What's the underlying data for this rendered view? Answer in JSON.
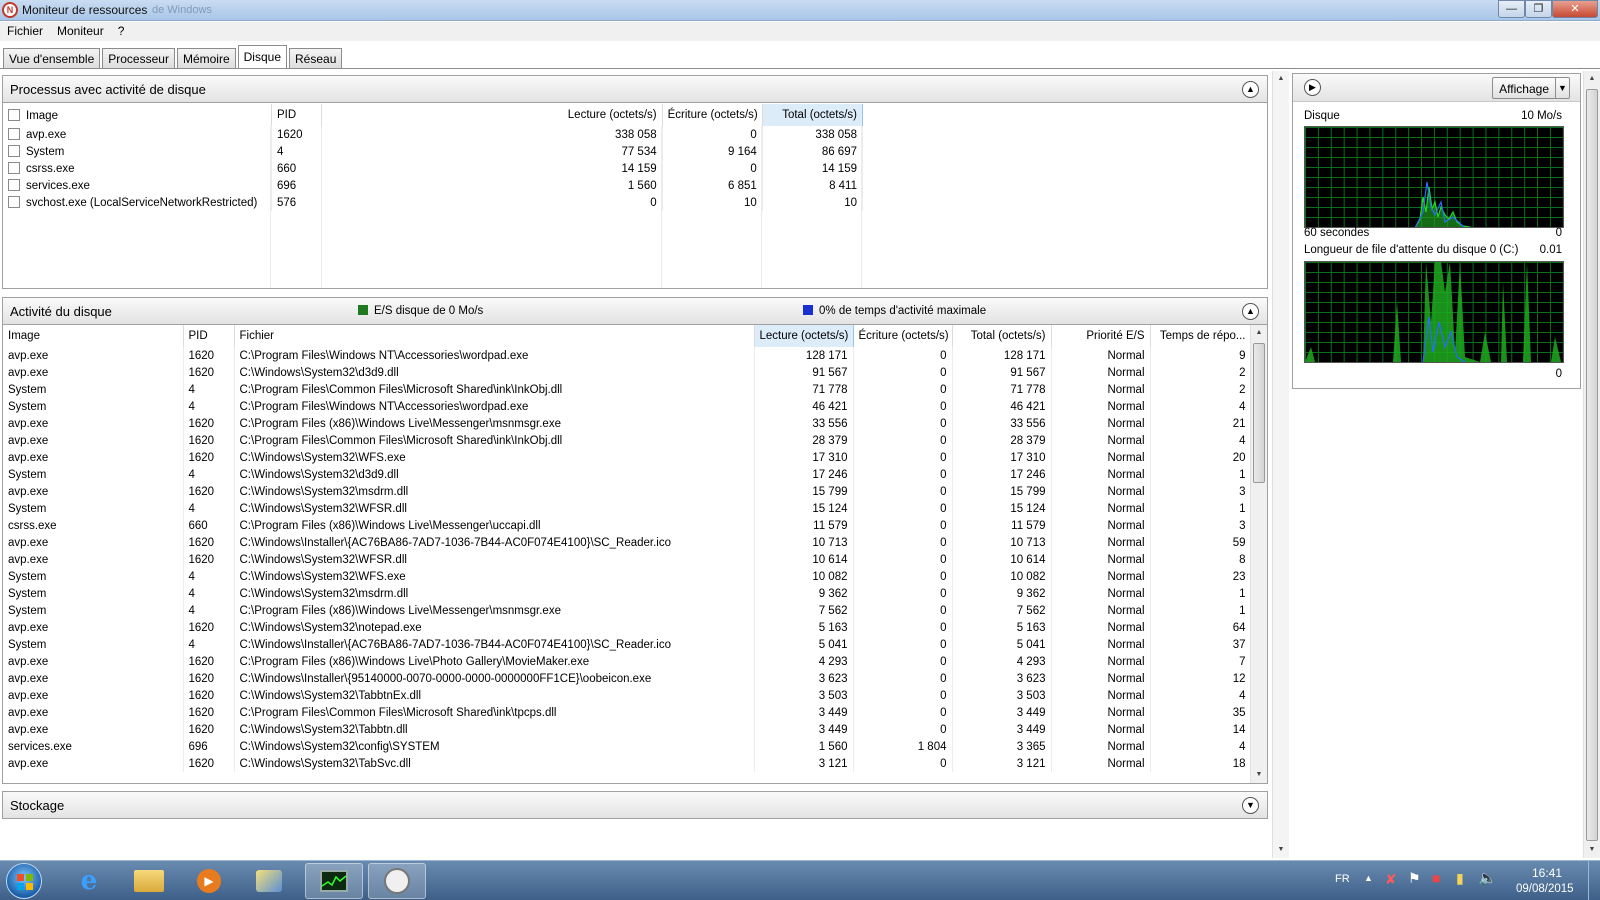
{
  "window": {
    "title": "Moniteur de ressources",
    "title_suffix": "de Windows"
  },
  "menu": [
    "Fichier",
    "Moniteur",
    "?"
  ],
  "tabs": [
    "Vue d'ensemble",
    "Processeur",
    "Mémoire",
    "Disque",
    "Réseau"
  ],
  "active_tab": "Disque",
  "processes": {
    "title": "Processus avec activité de disque",
    "columns": [
      "Image",
      "PID",
      "Lecture (octets/s)",
      "Écriture (octets/s)",
      "Total (octets/s)"
    ],
    "sorted_column": "Total (octets/s)",
    "rows": [
      {
        "image": "avp.exe",
        "pid": "1620",
        "read": "338 058",
        "write": "0",
        "total": "338 058"
      },
      {
        "image": "System",
        "pid": "4",
        "read": "77 534",
        "write": "9 164",
        "total": "86 697"
      },
      {
        "image": "csrss.exe",
        "pid": "660",
        "read": "14 159",
        "write": "0",
        "total": "14 159"
      },
      {
        "image": "services.exe",
        "pid": "696",
        "read": "1 560",
        "write": "6 851",
        "total": "8 411"
      },
      {
        "image": "svchost.exe (LocalServiceNetworkRestricted)",
        "pid": "576",
        "read": "0",
        "write": "10",
        "total": "10"
      }
    ]
  },
  "activity": {
    "title": "Activité du disque",
    "legend_io": "E/S disque de 0 Mo/s",
    "legend_io_color": "#1f7a1f",
    "legend_time": "0% de temps d'activité maximale",
    "legend_time_color": "#1a2fd0",
    "columns": [
      "Image",
      "PID",
      "Fichier",
      "Lecture (octets/s)",
      "Écriture (octets/s)",
      "Total (octets/s)",
      "Priorité E/S",
      "Temps de répo..."
    ],
    "sorted_column": "Lecture (octets/s)",
    "rows": [
      [
        "avp.exe",
        "1620",
        "C:\\Program Files\\Windows NT\\Accessories\\wordpad.exe",
        "128 171",
        "0",
        "128 171",
        "Normal",
        "9"
      ],
      [
        "avp.exe",
        "1620",
        "C:\\Windows\\System32\\d3d9.dll",
        "91 567",
        "0",
        "91 567",
        "Normal",
        "2"
      ],
      [
        "System",
        "4",
        "C:\\Program Files\\Common Files\\Microsoft Shared\\ink\\InkObj.dll",
        "71 778",
        "0",
        "71 778",
        "Normal",
        "2"
      ],
      [
        "System",
        "4",
        "C:\\Program Files\\Windows NT\\Accessories\\wordpad.exe",
        "46 421",
        "0",
        "46 421",
        "Normal",
        "4"
      ],
      [
        "avp.exe",
        "1620",
        "C:\\Program Files (x86)\\Windows Live\\Messenger\\msnmsgr.exe",
        "33 556",
        "0",
        "33 556",
        "Normal",
        "21"
      ],
      [
        "avp.exe",
        "1620",
        "C:\\Program Files\\Common Files\\Microsoft Shared\\ink\\InkObj.dll",
        "28 379",
        "0",
        "28 379",
        "Normal",
        "4"
      ],
      [
        "avp.exe",
        "1620",
        "C:\\Windows\\System32\\WFS.exe",
        "17 310",
        "0",
        "17 310",
        "Normal",
        "20"
      ],
      [
        "System",
        "4",
        "C:\\Windows\\System32\\d3d9.dll",
        "17 246",
        "0",
        "17 246",
        "Normal",
        "1"
      ],
      [
        "avp.exe",
        "1620",
        "C:\\Windows\\System32\\msdrm.dll",
        "15 799",
        "0",
        "15 799",
        "Normal",
        "3"
      ],
      [
        "System",
        "4",
        "C:\\Windows\\System32\\WFSR.dll",
        "15 124",
        "0",
        "15 124",
        "Normal",
        "1"
      ],
      [
        "csrss.exe",
        "660",
        "C:\\Program Files (x86)\\Windows Live\\Messenger\\uccapi.dll",
        "11 579",
        "0",
        "11 579",
        "Normal",
        "3"
      ],
      [
        "avp.exe",
        "1620",
        "C:\\Windows\\Installer\\{AC76BA86-7AD7-1036-7B44-AC0F074E4100}\\SC_Reader.ico",
        "10 713",
        "0",
        "10 713",
        "Normal",
        "59"
      ],
      [
        "avp.exe",
        "1620",
        "C:\\Windows\\System32\\WFSR.dll",
        "10 614",
        "0",
        "10 614",
        "Normal",
        "8"
      ],
      [
        "System",
        "4",
        "C:\\Windows\\System32\\WFS.exe",
        "10 082",
        "0",
        "10 082",
        "Normal",
        "23"
      ],
      [
        "System",
        "4",
        "C:\\Windows\\System32\\msdrm.dll",
        "9 362",
        "0",
        "9 362",
        "Normal",
        "1"
      ],
      [
        "System",
        "4",
        "C:\\Program Files (x86)\\Windows Live\\Messenger\\msnmsgr.exe",
        "7 562",
        "0",
        "7 562",
        "Normal",
        "1"
      ],
      [
        "avp.exe",
        "1620",
        "C:\\Windows\\System32\\notepad.exe",
        "5 163",
        "0",
        "5 163",
        "Normal",
        "64"
      ],
      [
        "System",
        "4",
        "C:\\Windows\\Installer\\{AC76BA86-7AD7-1036-7B44-AC0F074E4100}\\SC_Reader.ico",
        "5 041",
        "0",
        "5 041",
        "Normal",
        "37"
      ],
      [
        "avp.exe",
        "1620",
        "C:\\Program Files (x86)\\Windows Live\\Photo Gallery\\MovieMaker.exe",
        "4 293",
        "0",
        "4 293",
        "Normal",
        "7"
      ],
      [
        "avp.exe",
        "1620",
        "C:\\Windows\\Installer\\{95140000-0070-0000-0000-0000000FF1CE}\\oobeicon.exe",
        "3 623",
        "0",
        "3 623",
        "Normal",
        "12"
      ],
      [
        "avp.exe",
        "1620",
        "C:\\Windows\\System32\\TabbtnEx.dll",
        "3 503",
        "0",
        "3 503",
        "Normal",
        "4"
      ],
      [
        "avp.exe",
        "1620",
        "C:\\Program Files\\Common Files\\Microsoft Shared\\ink\\tpcps.dll",
        "3 449",
        "0",
        "3 449",
        "Normal",
        "35"
      ],
      [
        "avp.exe",
        "1620",
        "C:\\Windows\\System32\\Tabbtn.dll",
        "3 449",
        "0",
        "3 449",
        "Normal",
        "14"
      ],
      [
        "services.exe",
        "696",
        "C:\\Windows\\System32\\config\\SYSTEM",
        "1 560",
        "1 804",
        "3 365",
        "Normal",
        "4"
      ],
      [
        "avp.exe",
        "1620",
        "C:\\Windows\\System32\\TabSvc.dll",
        "3 121",
        "0",
        "3 121",
        "Normal",
        "18"
      ]
    ]
  },
  "storage": {
    "title": "Stockage"
  },
  "side": {
    "view_button": "Affichage",
    "disk_graph": {
      "label": "Disque",
      "max": "10 Mo/s",
      "time": "60 secondes",
      "min": "0"
    },
    "queue_graph": {
      "label": "Longueur de file d'attente du disque 0 (C:)",
      "max": "0.01",
      "min": "0"
    },
    "graph_color": "#22dd22",
    "graph_color2": "#2a6cff"
  },
  "taskbar": {
    "lang": "FR",
    "time": "16:41",
    "date": "09/08/2015"
  }
}
